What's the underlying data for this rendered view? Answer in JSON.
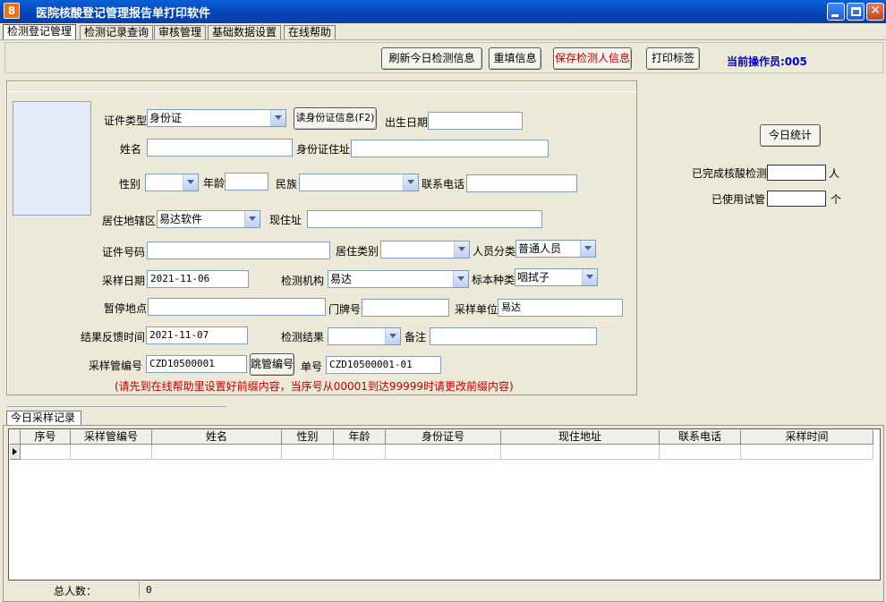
{
  "window": {
    "title": "医院核酸登记管理报告单打印软件",
    "icon": "8"
  },
  "tabs": [
    "检测登记管理",
    "检测记录查询",
    "审核管理",
    "基础数据设置",
    "在线帮助"
  ],
  "toolbar": {
    "refresh_label": "刷新今日检测信息",
    "reset_label": "重填信息",
    "save_label": "保存检测人信息",
    "print_label": "打印标签",
    "operator_text": "当前操作员:005",
    "save_color": "#c00000"
  },
  "form": {
    "id_type_label": "证件类型",
    "id_type_value": "身份证",
    "read_id_label": "读身份证信息(F2)",
    "birth_label": "出生日期",
    "birth_value": "",
    "name_label": "姓名",
    "name_value": "",
    "id_address_label": "身份证住址",
    "id_address_value": "",
    "gender_label": "性别",
    "gender_value": "",
    "age_label": "年龄",
    "age_value": "",
    "ethnicity_label": "民族",
    "ethnicity_value": "",
    "phone_label": "联系电话",
    "phone_value": "",
    "district_label": "居住地辖区",
    "district_value": "易达软件",
    "current_address_label": "现住址",
    "current_address_value": "",
    "id_number_label": "证件号码",
    "id_number_value": "",
    "residence_type_label": "居住类别",
    "residence_type_value": "",
    "person_class_label": "人员分类",
    "person_class_value": "普通人员",
    "sample_date_label": "采样日期",
    "sample_date_value": "2021-11-06",
    "lab_label": "检测机构",
    "lab_value": "易达",
    "specimen_label": "标本种类",
    "specimen_value": "咽拭子",
    "stay_place_label": "暂停地点",
    "stay_place_value": "",
    "door_label": "门牌号",
    "door_value": "",
    "sample_unit_label": "采样单位",
    "sample_unit_value": "易达",
    "result_time_label": "结果反馈时间",
    "result_time_value": "2021-11-07",
    "result_label": "检测结果",
    "result_value": "",
    "remark_label": "备注",
    "remark_value": "",
    "tube_label": "采样管编号",
    "tube_value": "CZD10500001",
    "skip_tube_label": "跳管编号",
    "order_label": "单号",
    "order_value": "CZD10500001-01",
    "hint": "(请先到在线帮助里设置好前缀内容，当序号从00001到达99999时请更改前缀内容)"
  },
  "stats": {
    "today_button": "今日统计",
    "done_label": "已完成核酸检测",
    "done_value": "",
    "done_unit": "人",
    "tubes_label": "已使用试管",
    "tubes_value": "",
    "tubes_unit": "个"
  },
  "records": {
    "tab_label": "今日采样记录",
    "columns": [
      "序号",
      "采样管编号",
      "姓名",
      "性别",
      "年龄",
      "身份证号",
      "现住地址",
      "联系电话",
      "采样时间"
    ],
    "total_label": "总人数：",
    "total_value": "0"
  }
}
